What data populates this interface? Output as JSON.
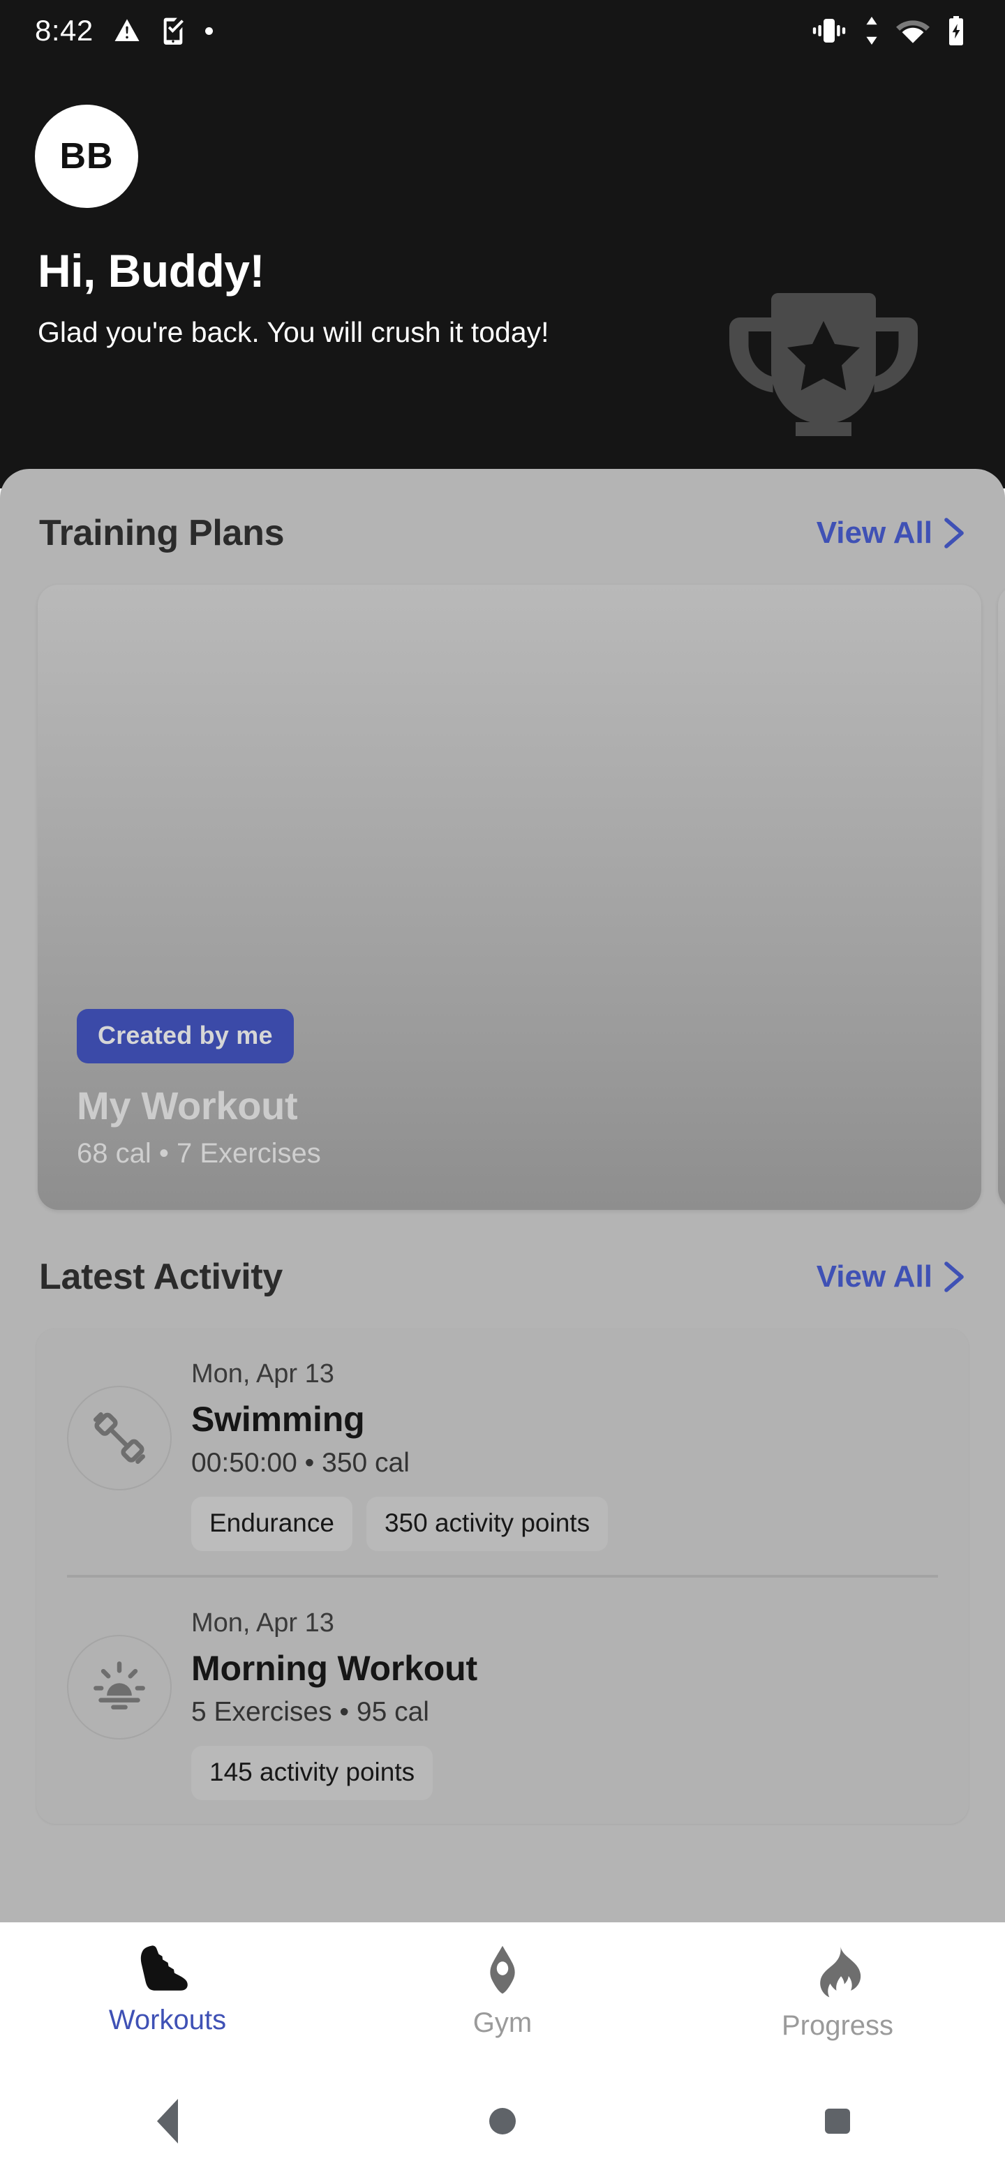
{
  "status_bar": {
    "time": "8:42",
    "left_icons": [
      "warning-triangle-icon",
      "phone-check-icon",
      "dot-icon"
    ],
    "right_icons": [
      "vibrate-icon",
      "data-transfer-icon",
      "wifi-icon",
      "battery-charging-icon"
    ]
  },
  "header": {
    "avatar_initials": "BB",
    "greeting": "Hi, Buddy!",
    "subtitle": "Glad you're back. You will crush it today!",
    "decoration_icon": "trophy-icon"
  },
  "training_plans": {
    "title": "Training Plans",
    "view_all": "View All",
    "cards": [
      {
        "badge": "Created by me",
        "name": "My Workout",
        "meta": "68 cal • 7 Exercises"
      }
    ]
  },
  "latest_activity": {
    "title": "Latest Activity",
    "view_all": "View All",
    "items": [
      {
        "date": "Mon, Apr 13",
        "title": "Swimming",
        "meta": "00:50:00 • 350 cal",
        "icon": "dumbbell-icon",
        "tags": [
          "Endurance",
          "350 activity points"
        ]
      },
      {
        "date": "Mon, Apr 13",
        "title": "Morning Workout",
        "meta": "5 Exercises • 95 cal",
        "icon": "sunrise-icon",
        "tags": [
          "145 activity points"
        ]
      }
    ]
  },
  "bottom_nav": {
    "items": [
      {
        "label": "Workouts",
        "icon": "sneaker-icon",
        "active": true
      },
      {
        "label": "Gym",
        "icon": "gym-ring-icon",
        "active": false
      },
      {
        "label": "Progress",
        "icon": "flame-icon",
        "active": false
      }
    ]
  },
  "system_nav": {
    "back": "back-triangle-icon",
    "home": "home-circle-icon",
    "recents": "recents-square-icon"
  },
  "colors": {
    "hero_background": "#151515",
    "sheet_background": "#b4b4b4",
    "accent": "#3f51b5",
    "badge_background": "#3b4aa8",
    "tab_inactive": "#9a9a9a"
  }
}
